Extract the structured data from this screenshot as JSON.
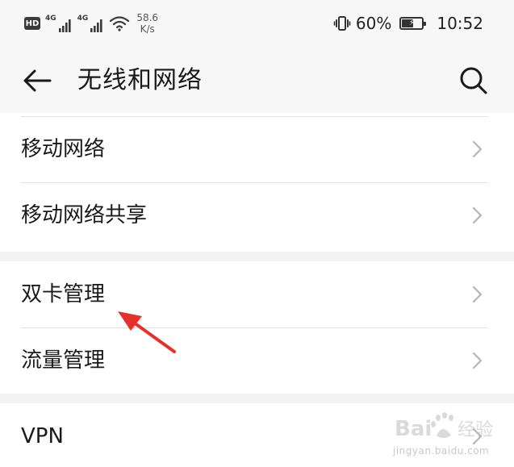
{
  "status_bar": {
    "hd_label": "HD",
    "sim1_net": "4G",
    "sim2_net": "4G",
    "speed_value": "58.6",
    "speed_unit": "K/s",
    "battery_percent": "60%",
    "battery_level": 0.6,
    "time": "10:52"
  },
  "header": {
    "title": "无线和网络"
  },
  "sections": [
    {
      "items": [
        {
          "label": "移动网络"
        },
        {
          "label": "移动网络共享"
        }
      ]
    },
    {
      "items": [
        {
          "label": "双卡管理"
        },
        {
          "label": "流量管理"
        }
      ]
    },
    {
      "items": [
        {
          "label": "VPN"
        }
      ]
    }
  ],
  "annotation_color": "#e8302a",
  "watermark": {
    "text": "jingyan.baidu.com"
  }
}
